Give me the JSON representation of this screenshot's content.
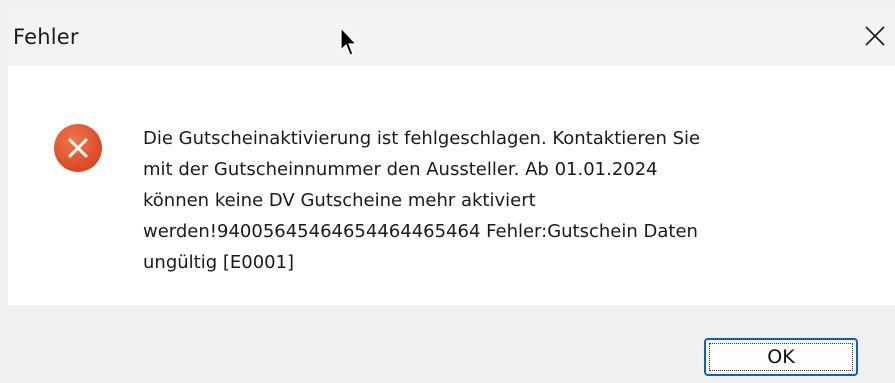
{
  "window": {
    "title": "Fehler"
  },
  "dialog": {
    "icon": "error-x-icon",
    "icon_color": "#e0532c",
    "message": "Die Gutscheinaktivierung ist fehlgeschlagen. Kontaktieren Sie\nmit der Gutscheinnummer den Aussteller. Ab 01.01.2024\nkönnen keine DV Gutscheine mehr aktiviert\nwerden!94005645464654464465464 Fehler:Gutschein Daten\nungültig [E0001]"
  },
  "buttons": {
    "ok_label": "OK"
  },
  "colors": {
    "accent": "#0a5fc9",
    "titlebar_bg": "#f3f3f3",
    "footer_bg": "#f0f0f0"
  }
}
